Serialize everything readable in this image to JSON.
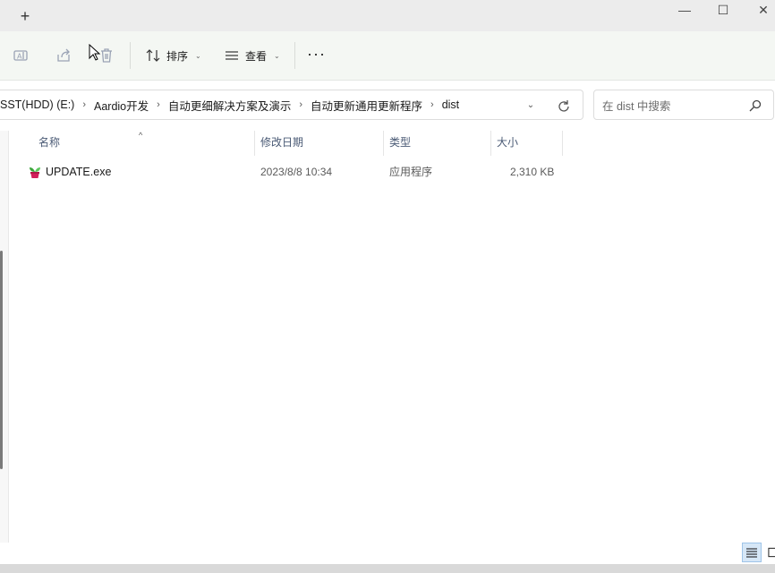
{
  "titlebar": {
    "new_tab_label": "+",
    "minimize_label": "—",
    "maximize_label": "☐",
    "close_label": "✕"
  },
  "toolbar": {
    "icons": [
      "rename-icon",
      "share-icon",
      "delete-icon"
    ],
    "sort_label": "排序",
    "view_label": "查看",
    "more_label": "···"
  },
  "address": {
    "crumbs": [
      "SST(HDD) (E:)",
      "Aardio开发",
      "自动更细解决方案及演示",
      "自动更新通用更新程序",
      "dist"
    ],
    "separator": "›"
  },
  "search": {
    "placeholder": "在 dist 中搜索"
  },
  "columns": {
    "name": "名称",
    "date": "修改日期",
    "type": "类型",
    "size": "大小"
  },
  "files": [
    {
      "name": "UPDATE.exe",
      "date": "2023/8/8 10:34",
      "type": "应用程序",
      "size": "2,310 KB",
      "icon": "app-exe-icon"
    }
  ],
  "colors": {
    "toolbar_bg": "#f4f7f3",
    "header_text": "#4a5a75",
    "selected_view": "#d6e7f7"
  }
}
